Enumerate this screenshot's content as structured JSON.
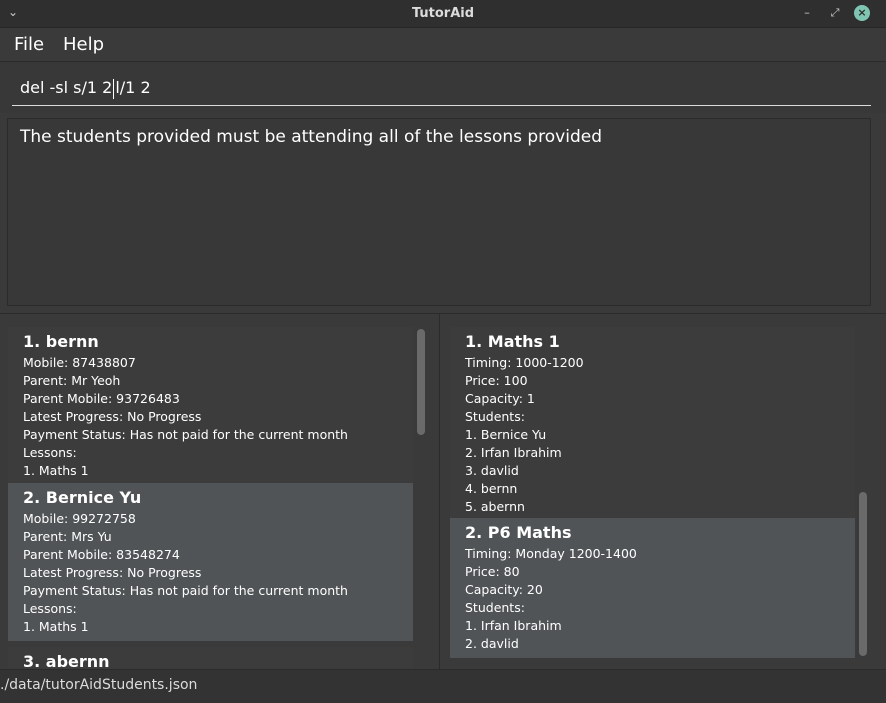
{
  "window": {
    "title": "TutorAid",
    "chevron": "⌄",
    "minimize": "–",
    "restore": "⤢",
    "close": "×"
  },
  "menu": {
    "file": "File",
    "help": "Help"
  },
  "command": {
    "before_caret": "del -sl s/1 2",
    "after_caret": "l/1 2"
  },
  "result": {
    "message": "The students provided must be attending all of the lessons provided"
  },
  "students": [
    {
      "heading": "1.  bernn",
      "lines": [
        "Mobile: 87438807",
        "Parent: Mr Yeoh",
        "Parent Mobile: 93726483",
        "Latest Progress: No Progress",
        "Payment Status: Has not paid for the current month",
        "Lessons:",
        "1.  Maths 1"
      ]
    },
    {
      "heading": "2.  Bernice Yu",
      "lines": [
        "Mobile: 99272758",
        "Parent: Mrs Yu",
        "Parent Mobile: 83548274",
        "Latest Progress: No Progress",
        "Payment Status: Has not paid for the current month",
        "Lessons:",
        "1.  Maths 1"
      ]
    },
    {
      "heading": "3.  abernn"
    }
  ],
  "lessons": [
    {
      "heading": "1.  Maths 1",
      "lines": [
        "Timing: 1000-1200",
        "Price: 100",
        "Capacity: 1",
        "Students:",
        "1.  Bernice Yu",
        "2.  Irfan Ibrahim",
        "3.  davlid",
        "4.  bernn",
        "5.  abernn"
      ]
    },
    {
      "heading": "2.  P6 Maths",
      "lines": [
        "Timing: Monday 1200-1400",
        "Price: 80",
        "Capacity: 20",
        "Students:",
        "1.  Irfan Ibrahim",
        "2.  davlid"
      ]
    }
  ],
  "status": {
    "save_path": "./data/tutorAidStudents.json"
  }
}
